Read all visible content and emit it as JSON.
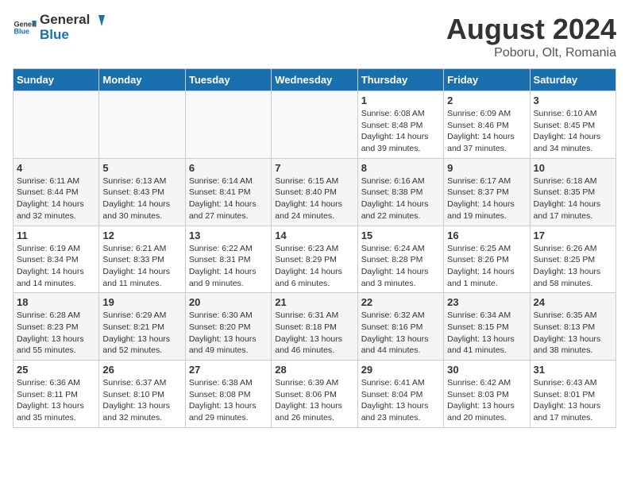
{
  "header": {
    "logo_general": "General",
    "logo_blue": "Blue",
    "title": "August 2024",
    "location": "Poboru, Olt, Romania"
  },
  "weekdays": [
    "Sunday",
    "Monday",
    "Tuesday",
    "Wednesday",
    "Thursday",
    "Friday",
    "Saturday"
  ],
  "weeks": [
    [
      {
        "day": "",
        "info": ""
      },
      {
        "day": "",
        "info": ""
      },
      {
        "day": "",
        "info": ""
      },
      {
        "day": "",
        "info": ""
      },
      {
        "day": "1",
        "info": "Sunrise: 6:08 AM\nSunset: 8:48 PM\nDaylight: 14 hours and 39 minutes."
      },
      {
        "day": "2",
        "info": "Sunrise: 6:09 AM\nSunset: 8:46 PM\nDaylight: 14 hours and 37 minutes."
      },
      {
        "day": "3",
        "info": "Sunrise: 6:10 AM\nSunset: 8:45 PM\nDaylight: 14 hours and 34 minutes."
      }
    ],
    [
      {
        "day": "4",
        "info": "Sunrise: 6:11 AM\nSunset: 8:44 PM\nDaylight: 14 hours and 32 minutes."
      },
      {
        "day": "5",
        "info": "Sunrise: 6:13 AM\nSunset: 8:43 PM\nDaylight: 14 hours and 30 minutes."
      },
      {
        "day": "6",
        "info": "Sunrise: 6:14 AM\nSunset: 8:41 PM\nDaylight: 14 hours and 27 minutes."
      },
      {
        "day": "7",
        "info": "Sunrise: 6:15 AM\nSunset: 8:40 PM\nDaylight: 14 hours and 24 minutes."
      },
      {
        "day": "8",
        "info": "Sunrise: 6:16 AM\nSunset: 8:38 PM\nDaylight: 14 hours and 22 minutes."
      },
      {
        "day": "9",
        "info": "Sunrise: 6:17 AM\nSunset: 8:37 PM\nDaylight: 14 hours and 19 minutes."
      },
      {
        "day": "10",
        "info": "Sunrise: 6:18 AM\nSunset: 8:35 PM\nDaylight: 14 hours and 17 minutes."
      }
    ],
    [
      {
        "day": "11",
        "info": "Sunrise: 6:19 AM\nSunset: 8:34 PM\nDaylight: 14 hours and 14 minutes."
      },
      {
        "day": "12",
        "info": "Sunrise: 6:21 AM\nSunset: 8:33 PM\nDaylight: 14 hours and 11 minutes."
      },
      {
        "day": "13",
        "info": "Sunrise: 6:22 AM\nSunset: 8:31 PM\nDaylight: 14 hours and 9 minutes."
      },
      {
        "day": "14",
        "info": "Sunrise: 6:23 AM\nSunset: 8:29 PM\nDaylight: 14 hours and 6 minutes."
      },
      {
        "day": "15",
        "info": "Sunrise: 6:24 AM\nSunset: 8:28 PM\nDaylight: 14 hours and 3 minutes."
      },
      {
        "day": "16",
        "info": "Sunrise: 6:25 AM\nSunset: 8:26 PM\nDaylight: 14 hours and 1 minute."
      },
      {
        "day": "17",
        "info": "Sunrise: 6:26 AM\nSunset: 8:25 PM\nDaylight: 13 hours and 58 minutes."
      }
    ],
    [
      {
        "day": "18",
        "info": "Sunrise: 6:28 AM\nSunset: 8:23 PM\nDaylight: 13 hours and 55 minutes."
      },
      {
        "day": "19",
        "info": "Sunrise: 6:29 AM\nSunset: 8:21 PM\nDaylight: 13 hours and 52 minutes."
      },
      {
        "day": "20",
        "info": "Sunrise: 6:30 AM\nSunset: 8:20 PM\nDaylight: 13 hours and 49 minutes."
      },
      {
        "day": "21",
        "info": "Sunrise: 6:31 AM\nSunset: 8:18 PM\nDaylight: 13 hours and 46 minutes."
      },
      {
        "day": "22",
        "info": "Sunrise: 6:32 AM\nSunset: 8:16 PM\nDaylight: 13 hours and 44 minutes."
      },
      {
        "day": "23",
        "info": "Sunrise: 6:34 AM\nSunset: 8:15 PM\nDaylight: 13 hours and 41 minutes."
      },
      {
        "day": "24",
        "info": "Sunrise: 6:35 AM\nSunset: 8:13 PM\nDaylight: 13 hours and 38 minutes."
      }
    ],
    [
      {
        "day": "25",
        "info": "Sunrise: 6:36 AM\nSunset: 8:11 PM\nDaylight: 13 hours and 35 minutes."
      },
      {
        "day": "26",
        "info": "Sunrise: 6:37 AM\nSunset: 8:10 PM\nDaylight: 13 hours and 32 minutes."
      },
      {
        "day": "27",
        "info": "Sunrise: 6:38 AM\nSunset: 8:08 PM\nDaylight: 13 hours and 29 minutes."
      },
      {
        "day": "28",
        "info": "Sunrise: 6:39 AM\nSunset: 8:06 PM\nDaylight: 13 hours and 26 minutes."
      },
      {
        "day": "29",
        "info": "Sunrise: 6:41 AM\nSunset: 8:04 PM\nDaylight: 13 hours and 23 minutes."
      },
      {
        "day": "30",
        "info": "Sunrise: 6:42 AM\nSunset: 8:03 PM\nDaylight: 13 hours and 20 minutes."
      },
      {
        "day": "31",
        "info": "Sunrise: 6:43 AM\nSunset: 8:01 PM\nDaylight: 13 hours and 17 minutes."
      }
    ]
  ]
}
